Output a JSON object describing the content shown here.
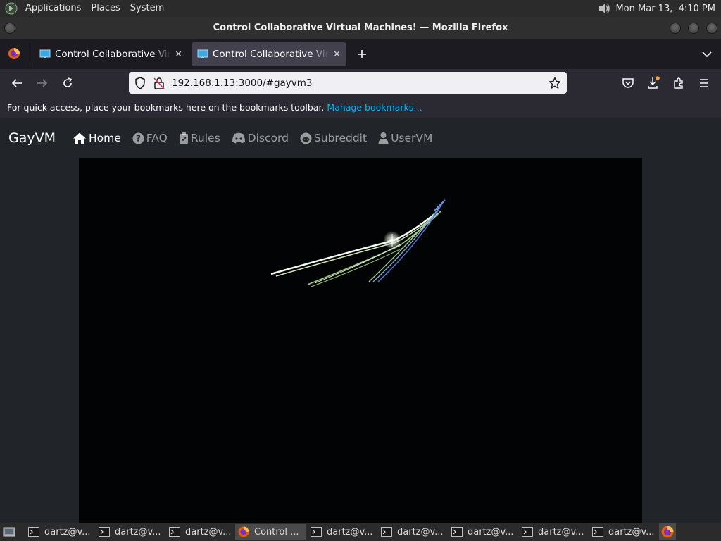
{
  "panel": {
    "menus": [
      "Applications",
      "Places",
      "System"
    ],
    "clock": "Mon Mar 13,  4:10 PM"
  },
  "window": {
    "title": "Control Collaborative Virtual Machines! — Mozilla Firefox"
  },
  "tabs": [
    {
      "title": "Control Collaborative Virtual Machines!",
      "active": false
    },
    {
      "title": "Control Collaborative Virtual Machines!",
      "active": true
    }
  ],
  "navbar": {
    "url": "192.168.1.13:3000/#gayvm3"
  },
  "bookmarks_bar": {
    "message": "For quick access, place your bookmarks here on the bookmarks toolbar.",
    "link": "Manage bookmarks…"
  },
  "site": {
    "brand": "GayVM",
    "links": [
      {
        "label": "Home",
        "icon": "home-icon",
        "active": true
      },
      {
        "label": "FAQ",
        "icon": "question-icon",
        "active": false
      },
      {
        "label": "Rules",
        "icon": "clipboard-icon",
        "active": false
      },
      {
        "label": "Discord",
        "icon": "discord-icon",
        "active": false
      },
      {
        "label": "Subreddit",
        "icon": "reddit-icon",
        "active": false
      },
      {
        "label": "UserVM",
        "icon": "user-icon",
        "active": false
      }
    ]
  },
  "taskbar": {
    "items": [
      {
        "label": "dartz@v...",
        "icon": "terminal-icon"
      },
      {
        "label": "dartz@v...",
        "icon": "terminal-icon"
      },
      {
        "label": "dartz@v...",
        "icon": "terminal-icon"
      },
      {
        "label": "Control ...",
        "icon": "firefox-icon",
        "active": true
      },
      {
        "label": "dartz@v...",
        "icon": "terminal-icon"
      },
      {
        "label": "dartz@v...",
        "icon": "terminal-icon"
      },
      {
        "label": "dartz@v...",
        "icon": "terminal-icon"
      },
      {
        "label": "dartz@v...",
        "icon": "terminal-icon"
      },
      {
        "label": "dartz@v...",
        "icon": "terminal-icon"
      }
    ]
  },
  "colors": {
    "accent_link": "#00b3f4",
    "page_bg": "#212529"
  }
}
